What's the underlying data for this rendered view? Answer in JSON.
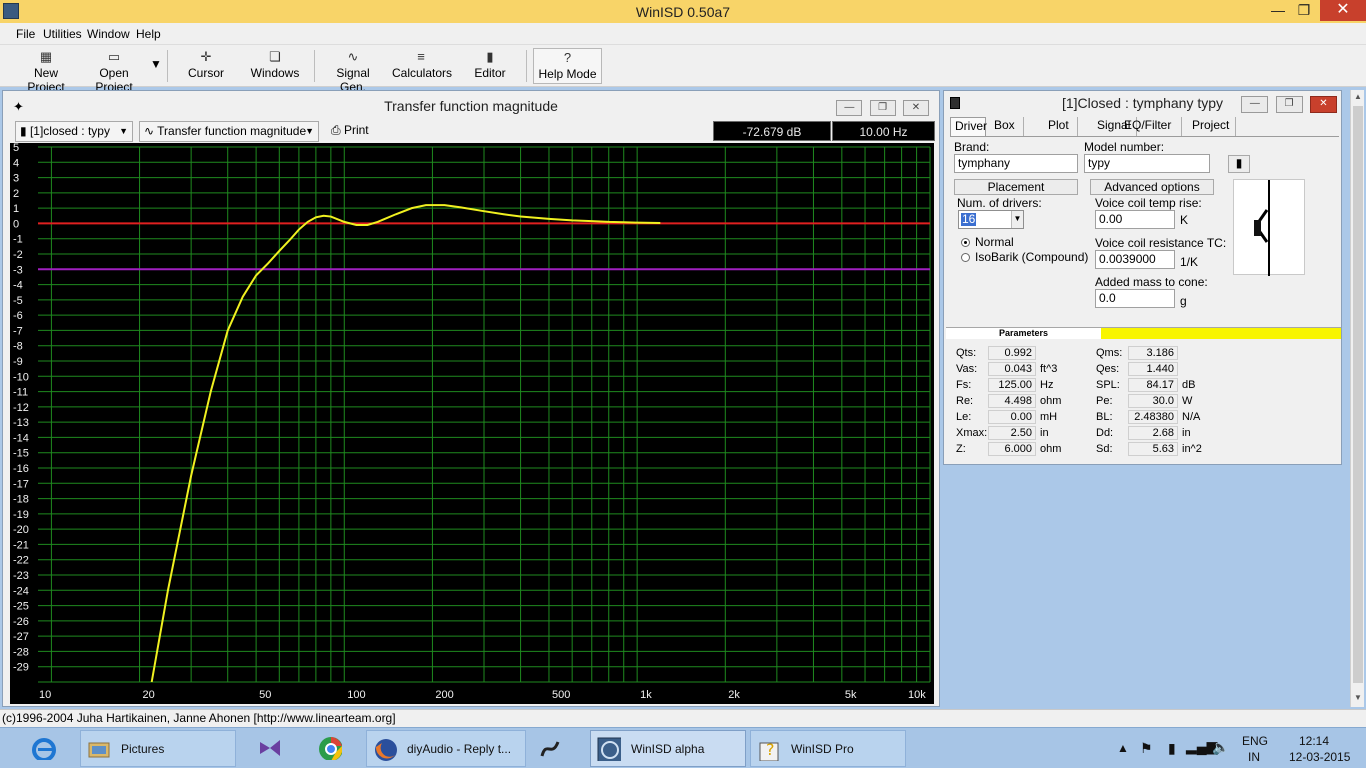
{
  "window": {
    "title": "WinISD 0.50a7"
  },
  "menu": {
    "items": [
      "File",
      "Utilities",
      "Window",
      "Help"
    ]
  },
  "toolbar": {
    "new_project": "New Project",
    "open_project": "Open Project",
    "cursor": "Cursor",
    "windows": "Windows",
    "signal_gen": "Signal Gen.",
    "calculators": "Calculators",
    "editor": "Editor",
    "help_mode": "Help Mode",
    "help_glyph": "?"
  },
  "plot_window": {
    "title": "Transfer function magnitude",
    "project_select": "[1]closed : typy",
    "plot_select": "Transfer function magnitude",
    "print": "Print",
    "readout_db": "-72.679 dB",
    "readout_hz": "10.00 Hz"
  },
  "chart_data": {
    "type": "line",
    "title": "Transfer function magnitude",
    "xlabel": "",
    "ylabel": "",
    "xscale": "log",
    "xlim": [
      9,
      1150
    ],
    "ylim": [
      -30,
      5
    ],
    "y_tick_labels": [
      "5",
      "4",
      "3",
      "2",
      "1",
      "0",
      "-1",
      "-2",
      "-3",
      "-4",
      "-5",
      "-6",
      "-7",
      "-8",
      "-9",
      "-10",
      "-11",
      "-12",
      "-13",
      "-14",
      "-15",
      "-16",
      "-17",
      "-18",
      "-19",
      "-20",
      "-21",
      "-22",
      "-23",
      "-24",
      "-25",
      "-26",
      "-27",
      "-28",
      "-29"
    ],
    "x_tick_labels": [
      "10",
      "20",
      "50",
      "100",
      "200",
      "500",
      "1k",
      "2k",
      "5k",
      "10k"
    ],
    "x_tick_values": [
      10,
      20,
      50,
      100,
      200,
      500,
      1000,
      2000,
      5000,
      10000
    ],
    "reference_lines": [
      {
        "y": 0,
        "color": "#e02020"
      },
      {
        "y": -3,
        "color": "#a020c0"
      }
    ],
    "grid": true,
    "grid_color": "#1f8a1f",
    "series": [
      {
        "color": "#f0f020",
        "x": [
          22,
          25,
          30,
          35,
          40,
          45,
          50,
          55,
          60,
          65,
          70,
          75,
          80,
          85,
          90,
          100,
          110,
          120,
          130,
          150,
          170,
          190,
          220,
          250,
          300,
          350,
          400,
          500,
          600,
          700,
          800,
          900,
          1000,
          1200
        ],
        "y": [
          -30,
          -24,
          -16.5,
          -11,
          -7,
          -4.8,
          -3.4,
          -2.6,
          -1.8,
          -1.1,
          -0.4,
          0.1,
          0.4,
          0.5,
          0.45,
          0.1,
          -0.1,
          -0.1,
          0.1,
          0.6,
          1.0,
          1.2,
          1.2,
          1.05,
          0.8,
          0.6,
          0.45,
          0.3,
          0.2,
          0.15,
          0.1,
          0.08,
          0.05,
          0.03
        ]
      }
    ]
  },
  "project_window": {
    "title": "[1]Closed : tymphany typy",
    "tabs": [
      "Driver",
      "Box",
      "Plot",
      "Signal",
      "EQ/Filter",
      "Project"
    ],
    "brand_label": "Brand:",
    "brand_value": "tymphany",
    "model_label": "Model number:",
    "model_value": "typy",
    "placement_button": "Placement",
    "advanced_button": "Advanced options",
    "num_drivers_label": "Num. of drivers:",
    "num_drivers_value": "16",
    "radio_normal": "Normal",
    "radio_isobarik": "IsoBarik (Compound)",
    "vc_temp_label": "Voice coil temp rise:",
    "vc_temp_value": "0.00",
    "vc_temp_unit": "K",
    "vc_res_label": "Voice coil resistance TC:",
    "vc_res_value": "0.0039000",
    "vc_res_unit": "1/K",
    "added_mass_label": "Added mass to cone:",
    "added_mass_value": "0.0",
    "added_mass_unit": "g",
    "parameters_label": "Parameters"
  },
  "parameters": {
    "left": [
      {
        "name": "Qts:",
        "value": "0.992",
        "unit": ""
      },
      {
        "name": "Vas:",
        "value": "0.043",
        "unit": "ft^3"
      },
      {
        "name": "Fs:",
        "value": "125.00",
        "unit": "Hz"
      },
      {
        "name": "Re:",
        "value": "4.498",
        "unit": "ohm"
      },
      {
        "name": "Le:",
        "value": "0.00",
        "unit": "mH"
      },
      {
        "name": "Xmax:",
        "value": "2.50",
        "unit": "in"
      },
      {
        "name": "Z:",
        "value": "6.000",
        "unit": "ohm"
      }
    ],
    "right": [
      {
        "name": "Qms:",
        "value": "3.186",
        "unit": ""
      },
      {
        "name": "Qes:",
        "value": "1.440",
        "unit": ""
      },
      {
        "name": "SPL:",
        "value": "84.17",
        "unit": "dB"
      },
      {
        "name": "Pe:",
        "value": "30.0",
        "unit": "W"
      },
      {
        "name": "BL:",
        "value": "2.48380",
        "unit": "N/A"
      },
      {
        "name": "Dd:",
        "value": "2.68",
        "unit": "in"
      },
      {
        "name": "Sd:",
        "value": "5.63",
        "unit": "in^2"
      }
    ]
  },
  "status": {
    "text": "(c)1996-2004 Juha Hartikainen, Janne Ahonen [http://www.linearteam.org]"
  },
  "taskbar": {
    "pictures": "Pictures",
    "firefox": "diyAudio - Reply t...",
    "winisd_alpha": "WinISD alpha",
    "winisd_pro": "WinISD Pro",
    "lang_top": "ENG",
    "lang_bottom": "IN",
    "time": "12:14",
    "date": "12-03-2015"
  }
}
